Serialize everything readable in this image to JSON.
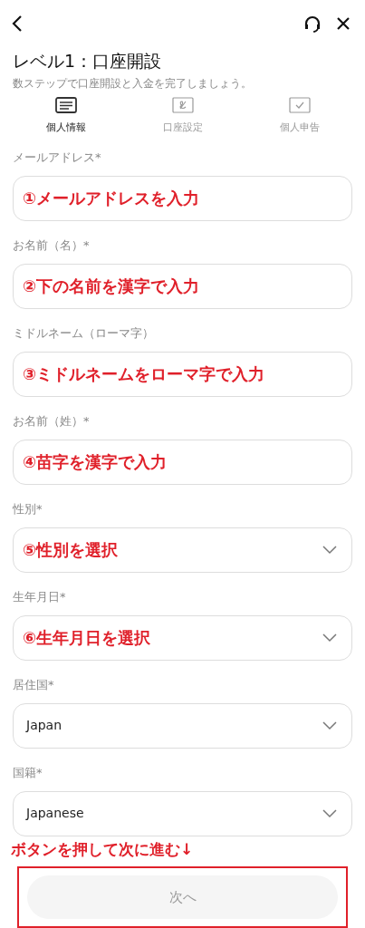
{
  "header": {
    "title": "レベル1：口座開設",
    "subtitle": "数ステップで口座開設と入金を完了しましょう。"
  },
  "steps": [
    {
      "label": "個人情報",
      "selected": true,
      "kind": "form"
    },
    {
      "label": "口座設定",
      "selected": false,
      "kind": "sign"
    },
    {
      "label": "個人申告",
      "selected": false,
      "kind": "check"
    }
  ],
  "fields": [
    {
      "label": "メールアドレス*",
      "kind": "text",
      "note": "①メールアドレスを入力"
    },
    {
      "label": "お名前（名）*",
      "kind": "text",
      "note": "②下の名前を漢字で入力"
    },
    {
      "label": "ミドルネーム（ローマ字）",
      "kind": "text",
      "note": "③ミドルネームをローマ字で入力"
    },
    {
      "label": "お名前（姓）*",
      "kind": "text",
      "note": "④苗字を漢字で入力"
    },
    {
      "label": "性別*",
      "kind": "select",
      "note": "⑤性別を選択"
    },
    {
      "label": "生年月日*",
      "kind": "select",
      "note": "⑥生年月日を選択"
    },
    {
      "label": "居住国*",
      "kind": "select",
      "value": "Japan"
    },
    {
      "label": "国籍*",
      "kind": "select",
      "value": "Japanese"
    }
  ],
  "bottom_note": "ボタンを押して次に進む↓",
  "next_button": {
    "label": "次へ",
    "disabled": true
  }
}
